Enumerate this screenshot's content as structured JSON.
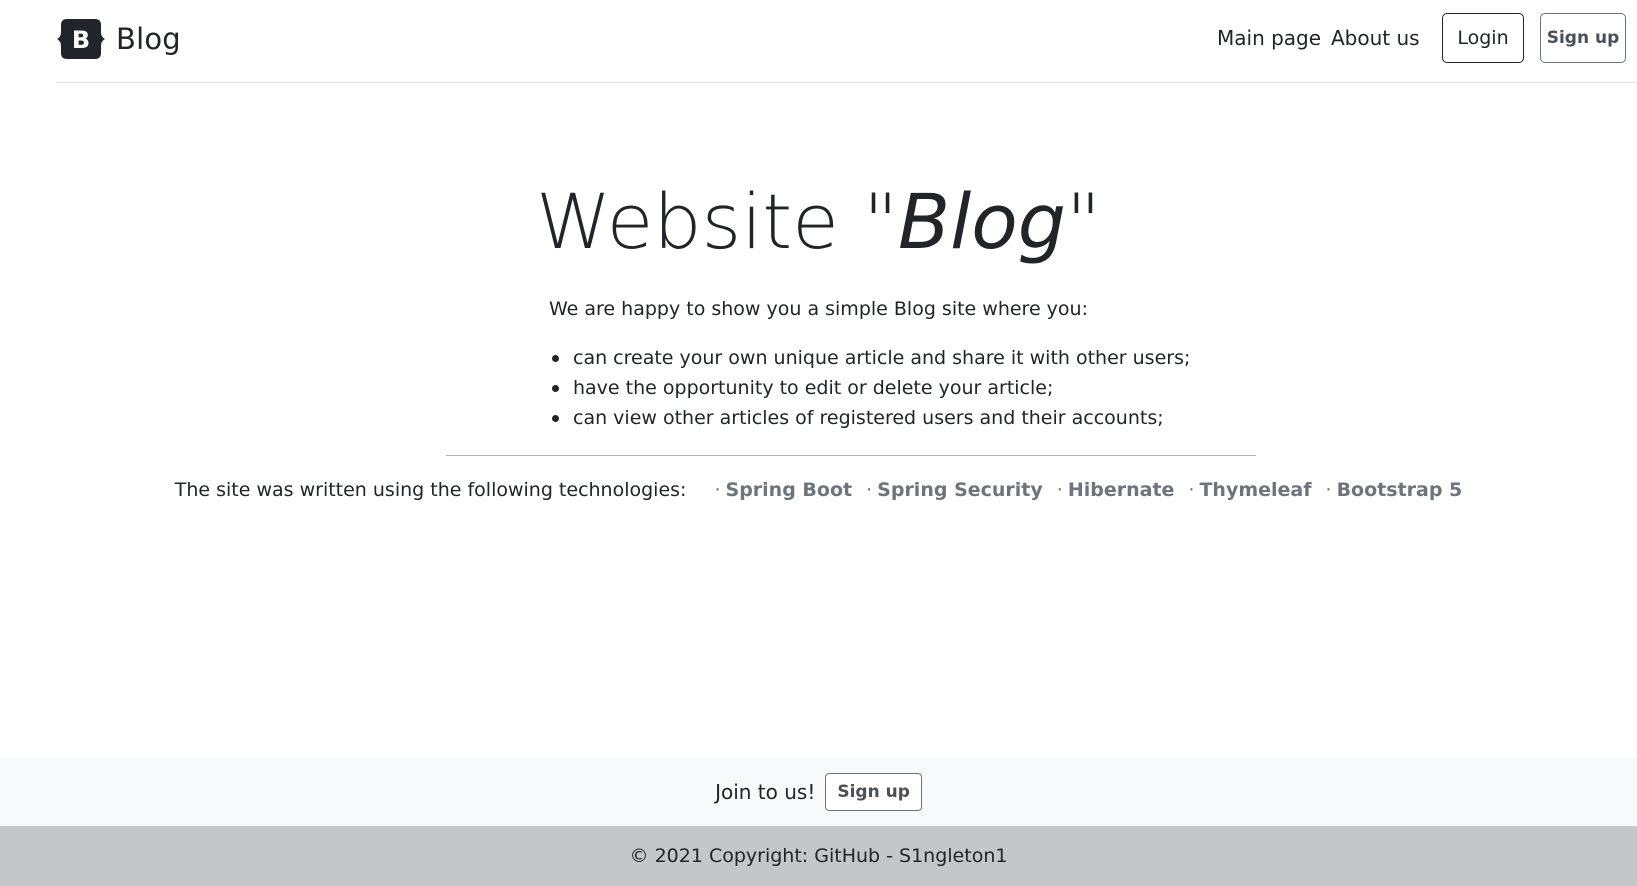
{
  "header": {
    "brand_text": "Blog",
    "nav": {
      "main_page": "Main page",
      "about_us": "About us"
    },
    "login_label": "Login",
    "signup_label": "Sign up"
  },
  "hero": {
    "title_prefix": "Website \"",
    "title_emphasis": "Blog",
    "title_suffix": "\"",
    "lead": "We are happy to show you a simple Blog site where you:",
    "features": [
      "can create your own unique article and share it with other users;",
      "have the opportunity to edit or delete your article;",
      "can view other articles of registered users and their accounts;"
    ]
  },
  "technologies": {
    "label": "The site was written using the following technologies:",
    "separator": "·",
    "items": [
      "Spring Boot",
      "Spring Security",
      "Hibernate",
      "Thymeleaf",
      "Bootstrap 5"
    ]
  },
  "join": {
    "text": "Join to us!",
    "button_label": "Sign up"
  },
  "footer": {
    "copyright": "© 2021 Copyright: GitHub - S1ngleton1"
  },
  "icons": {
    "brand_logo": "bootstrap-logo-icon"
  },
  "colors": {
    "text": "#212529",
    "muted": "#6c757d",
    "join_band": "#f8f9fa",
    "footer": "#c4c6c9"
  }
}
